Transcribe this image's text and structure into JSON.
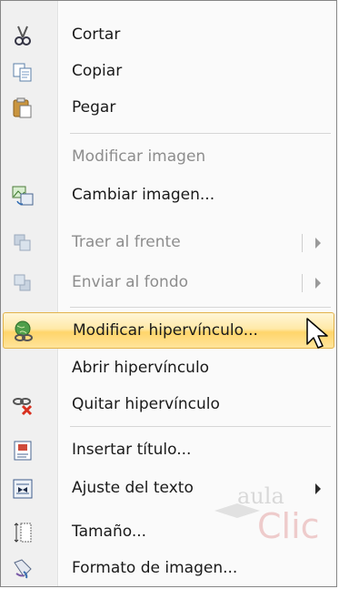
{
  "menu": {
    "items": [
      {
        "label": "Cortar",
        "icon": "scissors-icon",
        "disabled": false
      },
      {
        "label": "Copiar",
        "icon": "copy-icon",
        "disabled": false
      },
      {
        "label": "Pegar",
        "icon": "paste-icon",
        "disabled": false
      },
      {
        "label": "Modificar imagen",
        "icon": "",
        "disabled": true
      },
      {
        "label": "Cambiar imagen...",
        "icon": "change-picture-icon",
        "disabled": false
      },
      {
        "label": "Traer al frente",
        "icon": "bring-to-front-icon",
        "disabled": true,
        "submenu": true
      },
      {
        "label": "Enviar al fondo",
        "icon": "send-to-back-icon",
        "disabled": true,
        "submenu": true
      },
      {
        "label": "Modificar hipervínculo...",
        "icon": "hyperlink-globe-icon",
        "disabled": false,
        "highlighted": true
      },
      {
        "label": "Abrir hipervínculo",
        "icon": "",
        "disabled": false
      },
      {
        "label": "Quitar hipervínculo",
        "icon": "remove-hyperlink-icon",
        "disabled": false
      },
      {
        "label": "Insertar título...",
        "icon": "insert-caption-icon",
        "disabled": false
      },
      {
        "label": "Ajuste del texto",
        "icon": "text-wrapping-icon",
        "disabled": false,
        "submenu": true
      },
      {
        "label": "Tamaño...",
        "icon": "size-icon",
        "disabled": false
      },
      {
        "label": "Formato de imagen...",
        "icon": "format-picture-icon",
        "disabled": false
      }
    ]
  },
  "watermark": {
    "line1": "aula",
    "line2": "Clic"
  },
  "colors": {
    "highlight_top": "#fff6d7",
    "highlight_bottom": "#ffd56b",
    "highlight_border": "#e3b34b",
    "disabled_text": "#8d8d8d"
  }
}
